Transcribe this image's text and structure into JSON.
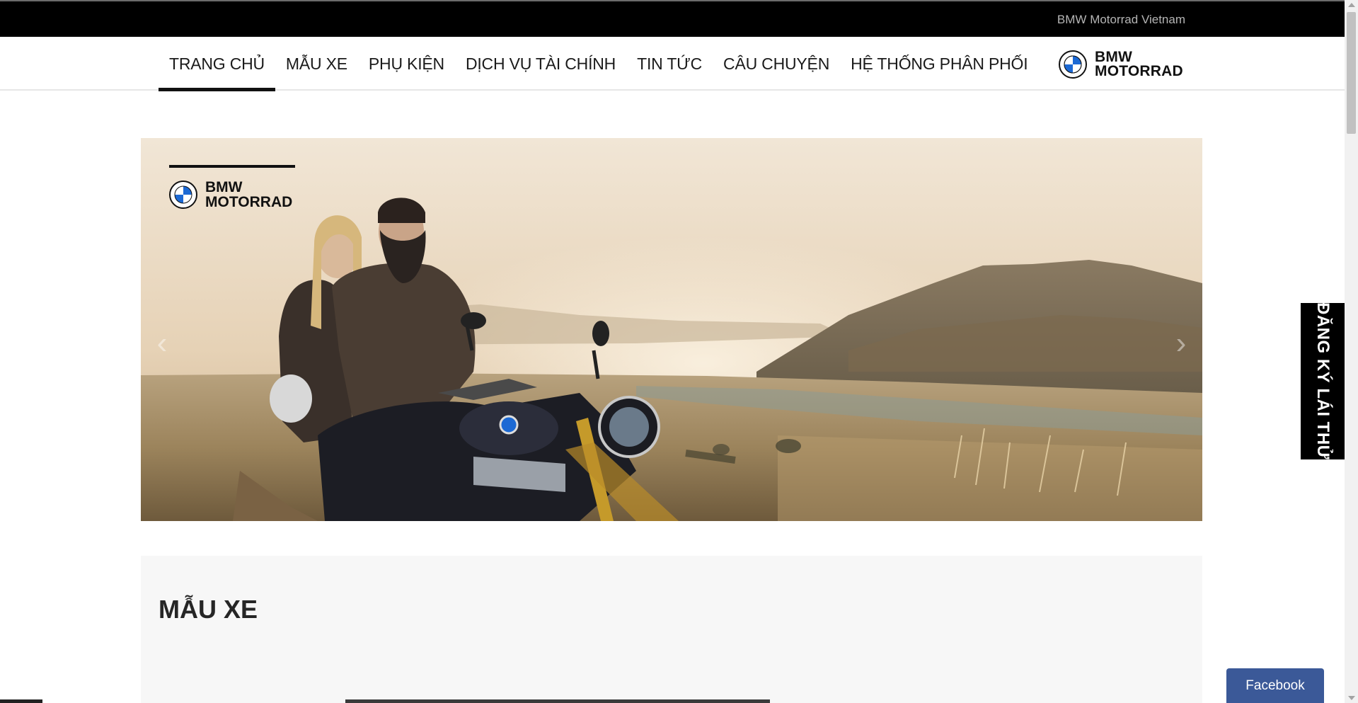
{
  "topbar": {
    "brand_text": "BMW Motorrad Vietnam"
  },
  "nav": {
    "items": [
      {
        "label": "TRANG CHỦ",
        "active": true
      },
      {
        "label": "MẪU XE"
      },
      {
        "label": "PHỤ KIỆN"
      },
      {
        "label": "DỊCH VỤ TÀI CHÍNH"
      },
      {
        "label": "TIN TỨC"
      },
      {
        "label": "CÂU CHUYỆN"
      },
      {
        "label": "HỆ THỐNG PHÂN PHỐI"
      }
    ],
    "logo_line1": "BMW",
    "logo_line2": "MOTORRAD"
  },
  "hero": {
    "logo_line1": "BMW",
    "logo_line2": "MOTORRAD",
    "prev_icon": "chevron-left-icon",
    "next_icon": "chevron-right-icon"
  },
  "models": {
    "title": "MẪU XE"
  },
  "side_tab": {
    "label": "ĐĂNG KÝ LÁI THỬ"
  },
  "facebook": {
    "label": "Facebook"
  },
  "colors": {
    "topbar_bg": "#000000",
    "nav_text": "#1a1a1a",
    "side_tab_bg": "#000000",
    "facebook_bg": "#3b5998",
    "bmw_blue": "#1c69d4"
  }
}
